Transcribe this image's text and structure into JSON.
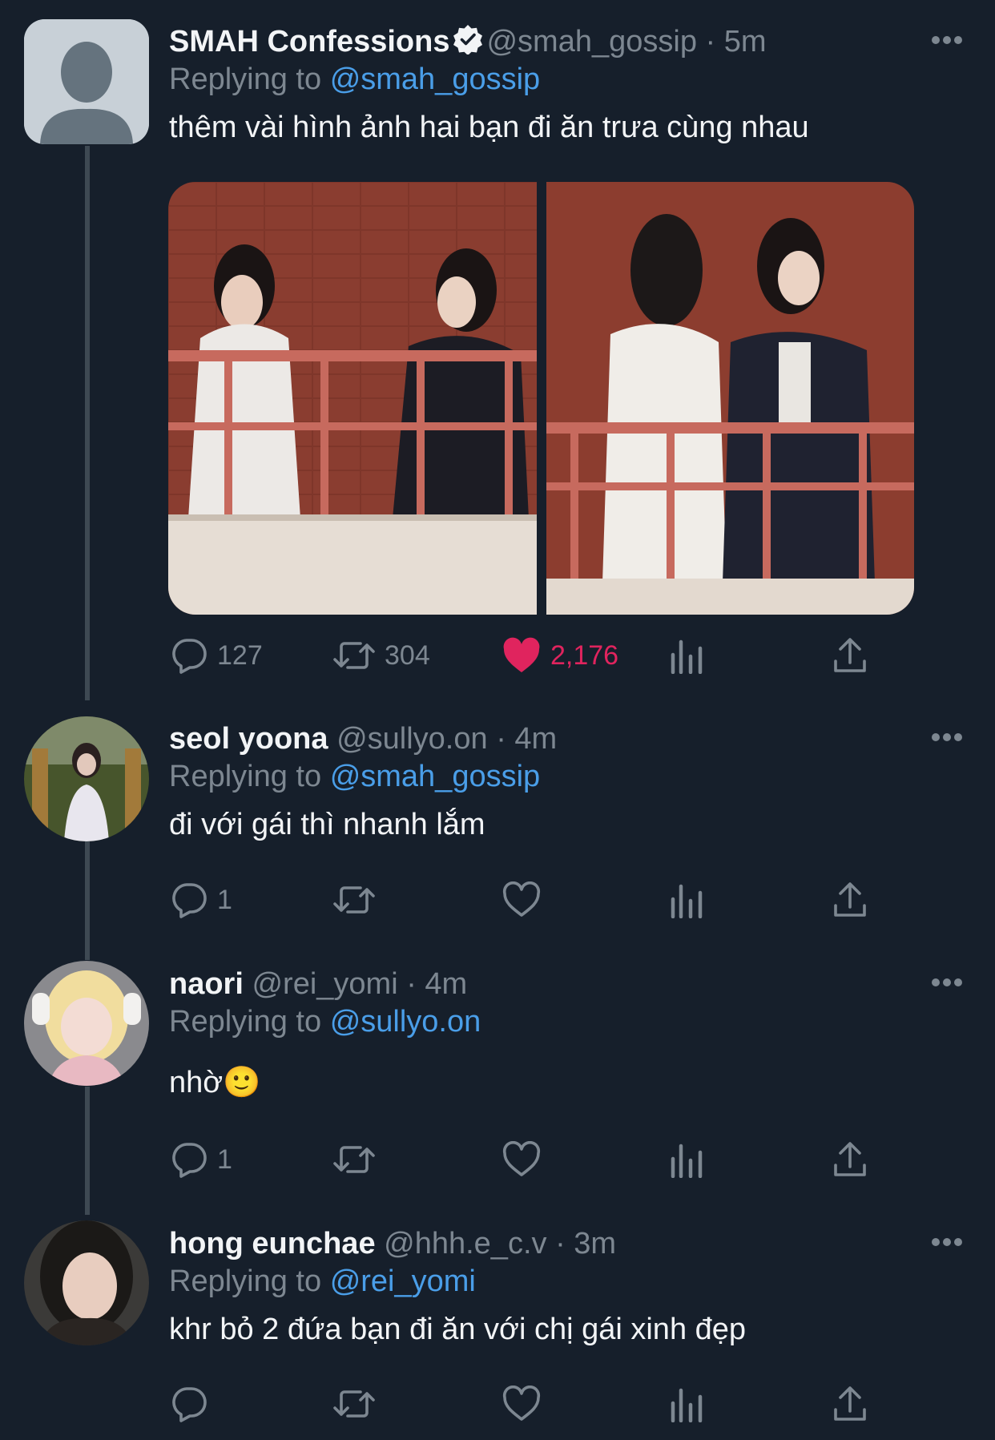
{
  "tweets": [
    {
      "name": "SMAH Confessions",
      "handle": "@smah_gossip",
      "time": "5m",
      "replying_label": "Replying to",
      "replying_to": "@smah_gossip",
      "text": "thêm vài hình ảnh hai bạn đi ăn trưa cùng nhau",
      "verified": true,
      "stats": {
        "replies": "127",
        "retweets": "304",
        "likes": "2,176",
        "liked": true
      }
    },
    {
      "name": "seol yoona",
      "handle": "@sullyo.on",
      "time": "4m",
      "replying_label": "Replying to",
      "replying_to": "@smah_gossip",
      "text": "đi với gái thì nhanh lắm",
      "stats": {
        "replies": "1",
        "retweets": "",
        "likes": ""
      }
    },
    {
      "name": "naori",
      "handle": "@rei_yomi",
      "time": "4m",
      "replying_label": "Replying to",
      "replying_to": "@sullyo.on",
      "text": "nhờ🙂",
      "stats": {
        "replies": "1",
        "retweets": "",
        "likes": ""
      }
    },
    {
      "name": "hong eunchae",
      "handle": "@hhh.e_c.v",
      "time": "3m",
      "replying_label": "Replying to",
      "replying_to": "@rei_yomi",
      "text": "khr bỏ 2 đứa bạn đi ăn với chị gái xinh đẹp",
      "stats": {
        "replies": "",
        "retweets": "",
        "likes": ""
      }
    }
  ],
  "separator": "·",
  "colors": {
    "background": "#161f2b",
    "link": "#4a9ee8",
    "muted": "#7d8791",
    "like": "#e0245e"
  },
  "icons": [
    "reply-icon",
    "retweet-icon",
    "like-icon",
    "views-icon",
    "share-icon",
    "more-icon",
    "verified-icon"
  ]
}
